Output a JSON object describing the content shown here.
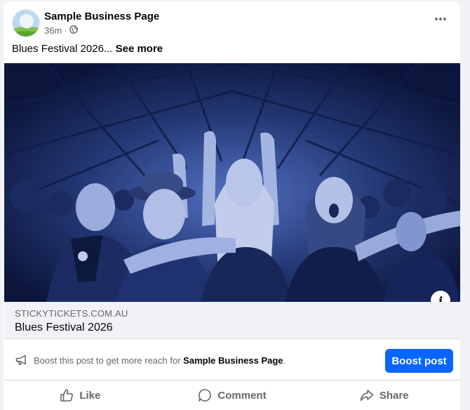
{
  "post": {
    "page_name": "Sample Business Page",
    "time": "36m",
    "separator": "·",
    "caption": "Blues Festival 2026...",
    "see_more": "See more",
    "more_icon": "more-horizontal-icon",
    "privacy_icon": "globe-icon"
  },
  "link_preview": {
    "image": "concert-crowd-photo",
    "domain": "STICKYTICKETS.COM.AU",
    "title": "Blues Festival 2026",
    "info_icon": "info-icon"
  },
  "boost": {
    "icon": "megaphone-icon",
    "text_prefix": "Boost this post to get more reach for ",
    "page_name": "Sample Business Page",
    "text_suffix": ".",
    "button_label": "Boost post",
    "button_color": "#0866ff"
  },
  "actions": [
    {
      "label": "Like",
      "icon": "thumbs-up-icon"
    },
    {
      "label": "Comment",
      "icon": "comment-icon"
    },
    {
      "label": "Share",
      "icon": "share-icon"
    }
  ]
}
